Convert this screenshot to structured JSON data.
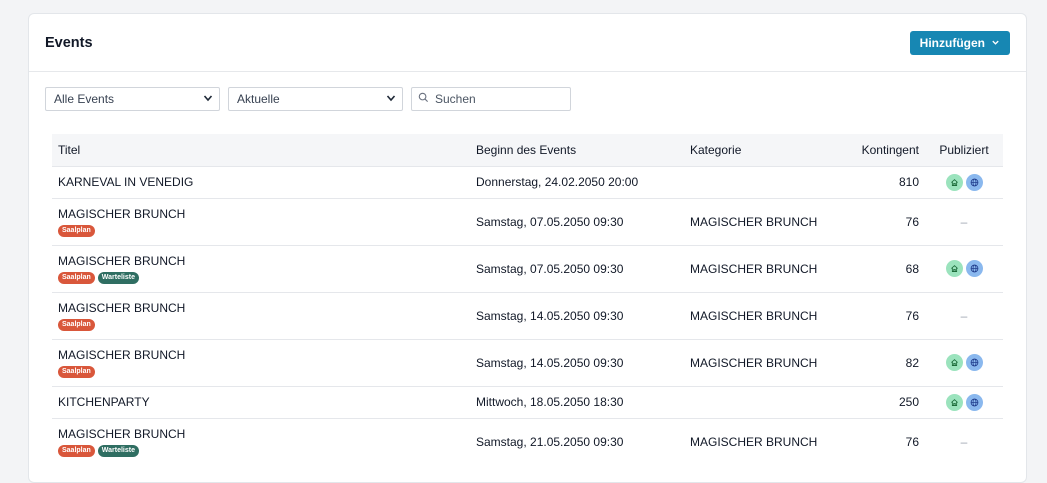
{
  "header": {
    "title": "Events",
    "add_button_label": "Hinzufügen"
  },
  "filters": {
    "events_select": "Alle Events",
    "time_select": "Aktuelle",
    "search_placeholder": "Suchen"
  },
  "table": {
    "columns": [
      "Titel",
      "Beginn des Events",
      "Kategorie",
      "Kontingent",
      "Publiziert"
    ],
    "rows": [
      {
        "title": "KARNEVAL IN VENEDIG",
        "badges": [],
        "date": "Donnerstag, 24.02.2050 20:00",
        "category": "",
        "kontingent": "810",
        "published": true
      },
      {
        "title": "MAGISCHER BRUNCH",
        "badges": [
          "Saalplan"
        ],
        "date": "Samstag, 07.05.2050 09:30",
        "category": "MAGISCHER BRUNCH",
        "kontingent": "76",
        "published": false
      },
      {
        "title": "MAGISCHER BRUNCH",
        "badges": [
          "Saalplan",
          "Warteliste"
        ],
        "date": "Samstag, 07.05.2050 09:30",
        "category": "MAGISCHER BRUNCH",
        "kontingent": "68",
        "published": true
      },
      {
        "title": "MAGISCHER BRUNCH",
        "badges": [
          "Saalplan"
        ],
        "date": "Samstag, 14.05.2050 09:30",
        "category": "MAGISCHER BRUNCH",
        "kontingent": "76",
        "published": false
      },
      {
        "title": "MAGISCHER BRUNCH",
        "badges": [
          "Saalplan"
        ],
        "date": "Samstag, 14.05.2050 09:30",
        "category": "MAGISCHER BRUNCH",
        "kontingent": "82",
        "published": true
      },
      {
        "title": "KITCHENPARTY",
        "badges": [],
        "date": "Mittwoch, 18.05.2050 18:30",
        "category": "",
        "kontingent": "250",
        "published": true
      },
      {
        "title": "MAGISCHER BRUNCH",
        "badges": [
          "Saalplan",
          "Warteliste"
        ],
        "date": "Samstag, 21.05.2050 09:30",
        "category": "MAGISCHER BRUNCH",
        "kontingent": "76",
        "published": false
      }
    ],
    "unpublished_marker": "–"
  },
  "colors": {
    "accent": "#1787b3",
    "badge_saalplan": "#d9573b",
    "badge_warteliste": "#2f6e62",
    "published_home": "#9be3bd",
    "published_web": "#8ab8ee"
  },
  "icons": {
    "add_button": "chevron-down-icon",
    "select": "chevron-down-icon",
    "search": "search-icon",
    "published_venue": "home-icon",
    "published_web": "globe-icon"
  }
}
